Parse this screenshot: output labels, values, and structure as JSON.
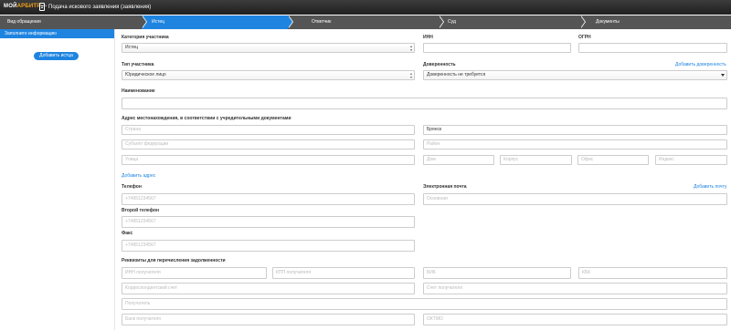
{
  "header": {
    "logo_main": "МОЙ",
    "logo_accent": "АРБИТР",
    "logo_sup": "beta",
    "title": "Подача искового заявления (заявления)"
  },
  "steps": [
    {
      "label": "Вид обращения",
      "active": false
    },
    {
      "label": "Истец",
      "active": true
    },
    {
      "label": "Ответчик",
      "active": false
    },
    {
      "label": "Суд",
      "active": false
    },
    {
      "label": "Документы",
      "active": false
    }
  ],
  "sidebar": {
    "item": "Заполните информацию",
    "add_button": "Добавить истца"
  },
  "form": {
    "category_label": "Категория участника",
    "category_value": "Истец",
    "inn_label": "ИНН",
    "ogrn_label": "ОГРН",
    "type_label": "Тип участника",
    "type_value": "Юридическое лицо",
    "power_label": "Доверенность",
    "power_value": "Доверенность не требуется",
    "add_power_link": "Добавить доверенность",
    "name_label": "Наименование",
    "address_label": "Адрес местонахождения, в соответствии с учредительными документами",
    "country_placeholder": "Страна",
    "city_value": "Брянск",
    "region_placeholder": "Субъект федерации",
    "district_placeholder": "Район",
    "street_placeholder": "Улица",
    "house_placeholder": "Дом",
    "building_placeholder": "Корпус",
    "office_placeholder": "Офис",
    "index_placeholder": "Индекс",
    "add_address_link": "Добавить адрес",
    "phone_label": "Телефон",
    "phone_placeholder": "+74951234567",
    "email_label": "Электронная почта",
    "email_placeholder": "Основная",
    "add_email_link": "Добавить почту",
    "phone2_label": "Второй телефон",
    "phone2_placeholder": "+74951234567",
    "fax_label": "Факс",
    "fax_placeholder": "+74951234567",
    "bank_label": "Реквизиты для перечисления задолженности",
    "inn_recipient_placeholder": "ИНН получателя",
    "kpp_recipient_placeholder": "КПП получателя",
    "bik_placeholder": "БИК",
    "kbk_placeholder": "КБК",
    "corr_account_placeholder": "Корреспондентский счет",
    "recipient_account_placeholder": "Счет получателя",
    "recipient_placeholder": "Получатель",
    "recipient_bank_placeholder": "Банк получателя",
    "oktmo_placeholder": "ОКТМО"
  },
  "colors": {
    "accent": "#1e84e0",
    "header_bg": "#2a2a2a",
    "steps_bg": "#555555"
  }
}
